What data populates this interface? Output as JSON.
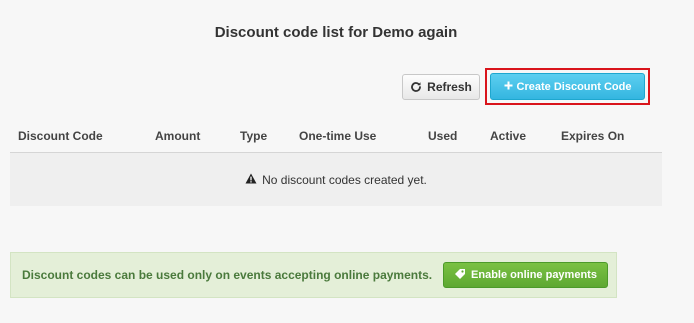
{
  "header": {
    "title": "Discount code list for Demo again"
  },
  "toolbar": {
    "refresh_label": "Refresh",
    "refresh_icon": "refresh-icon",
    "create_label": "Create Discount Code",
    "create_icon": "plus-icon"
  },
  "table": {
    "columns": [
      "Discount Code",
      "Amount",
      "Type",
      "One-time Use",
      "Used",
      "Active",
      "Expires On"
    ],
    "empty_message": "No discount codes created yet.",
    "empty_icon": "warning-icon"
  },
  "notice": {
    "message": "Discount codes can be used only on events accepting online payments.",
    "button_label": "Enable online payments",
    "button_icon": "tag-icon"
  },
  "colors": {
    "primary_button": "#34b6e0",
    "success_button": "#5ea832",
    "highlight": "#d9141b",
    "notice_bg": "#e4efd8",
    "notice_text": "#4a7a3c"
  }
}
